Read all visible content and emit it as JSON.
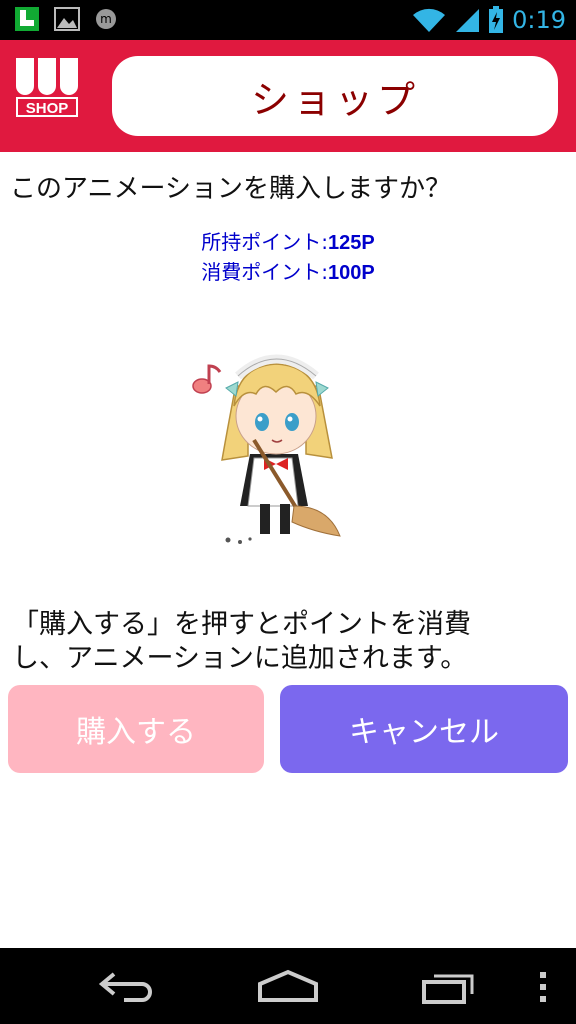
{
  "status_bar": {
    "time": "0:19",
    "icons": [
      "app-notification-icon",
      "image-notification-icon",
      "messenger-icon",
      "wifi-icon",
      "signal-icon",
      "battery-charging-icon"
    ]
  },
  "header": {
    "logo_text": "SHOP",
    "title": "ショップ",
    "color": "#e0193f"
  },
  "dialog": {
    "question": "このアニメーションを購入しますか？",
    "owned_label": "所持ポイント:",
    "owned_value": "125P",
    "cost_label": "消費ポイント:",
    "cost_value": "100P",
    "notice": "「購入する」を押すとポイントを消費し、アニメーションに追加されます。"
  },
  "buttons": {
    "buy_label": "購入する",
    "cancel_label": "キャンセル",
    "buy_color": "#ffb6c1",
    "cancel_color": "#7b68ee"
  },
  "nav_bar": {
    "icons": [
      "back-icon",
      "home-icon",
      "recent-apps-icon",
      "menu-icon"
    ]
  }
}
